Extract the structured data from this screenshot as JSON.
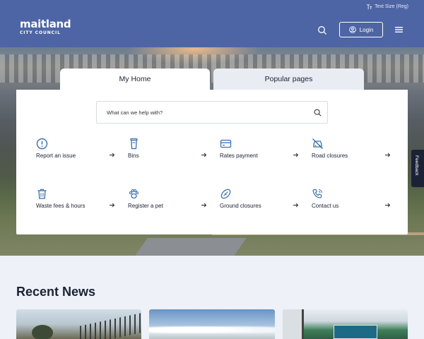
{
  "header": {
    "logo_word": "maitland",
    "logo_sub": "CITY COUNCIL",
    "text_size_label": "Text Size (Reg)",
    "login_label": "Login",
    "brand_color": "#4d65a4"
  },
  "tabs": [
    {
      "label": "My Home",
      "active": true
    },
    {
      "label": "Popular pages",
      "active": false
    }
  ],
  "search": {
    "placeholder": "What can we help with?"
  },
  "quick_links": [
    {
      "label": "Report an issue",
      "icon": "alert-circle-icon"
    },
    {
      "label": "Bins",
      "icon": "bin-icon"
    },
    {
      "label": "Rates payment",
      "icon": "credit-card-icon"
    },
    {
      "label": "Road closures",
      "icon": "car-off-icon"
    },
    {
      "label": "Waste fees & hours",
      "icon": "trash-icon"
    },
    {
      "label": "Register a pet",
      "icon": "paw-icon"
    },
    {
      "label": "Ground closures",
      "icon": "ball-icon"
    },
    {
      "label": "Contact us",
      "icon": "phone-icon"
    }
  ],
  "feedback": {
    "label": "Feedback"
  },
  "news": {
    "title": "Recent News"
  },
  "colors": {
    "accent": "#3a6fb0",
    "text": "#1b2236",
    "page_bg": "#eef1f7"
  }
}
